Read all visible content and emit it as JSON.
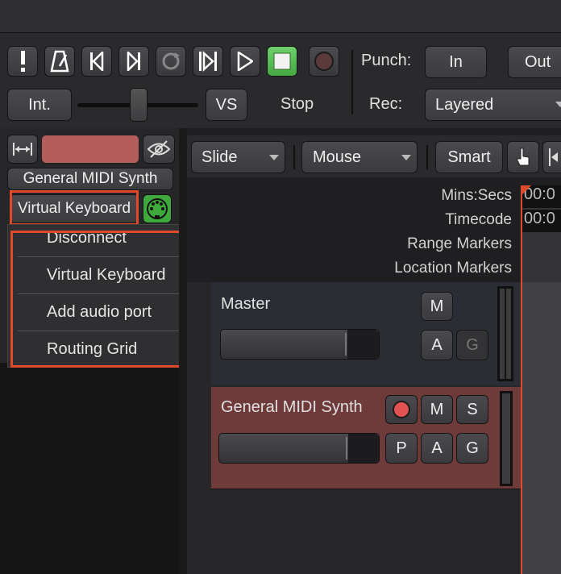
{
  "transport": {
    "int_label": "Int.",
    "vs_label": "VS",
    "stop_label": "Stop",
    "punch_label": "Punch:",
    "in_label": "In",
    "out_label": "Out",
    "rec_label": "Rec:",
    "rec_mode": "Layered"
  },
  "editor_toolbar": {
    "edit_mode": "Slide",
    "pointer_mode": "Mouse",
    "smart_label": "Smart"
  },
  "mixer_strip": {
    "track_name": "General MIDI Synth",
    "input_button": "Virtual Keyboard"
  },
  "context_menu": {
    "items": [
      "Disconnect",
      "Virtual Keyboard",
      "Add audio port",
      "Routing Grid"
    ]
  },
  "rulers": {
    "labels": [
      "Mins:Secs",
      "Timecode",
      "Range Markers",
      "Location Markers"
    ],
    "value1": "00:0",
    "value2": "00:0"
  },
  "tracks": {
    "master": {
      "name": "Master",
      "m": "M",
      "a": "A",
      "g": "G"
    },
    "midi": {
      "name": "General MIDI Synth",
      "m": "M",
      "s": "S",
      "p": "P",
      "a": "A",
      "g": "G"
    }
  },
  "colors": {
    "accent_red": "#e04a2a",
    "midi_track_bg": "#6e3a3a",
    "green": "#4caf50"
  }
}
